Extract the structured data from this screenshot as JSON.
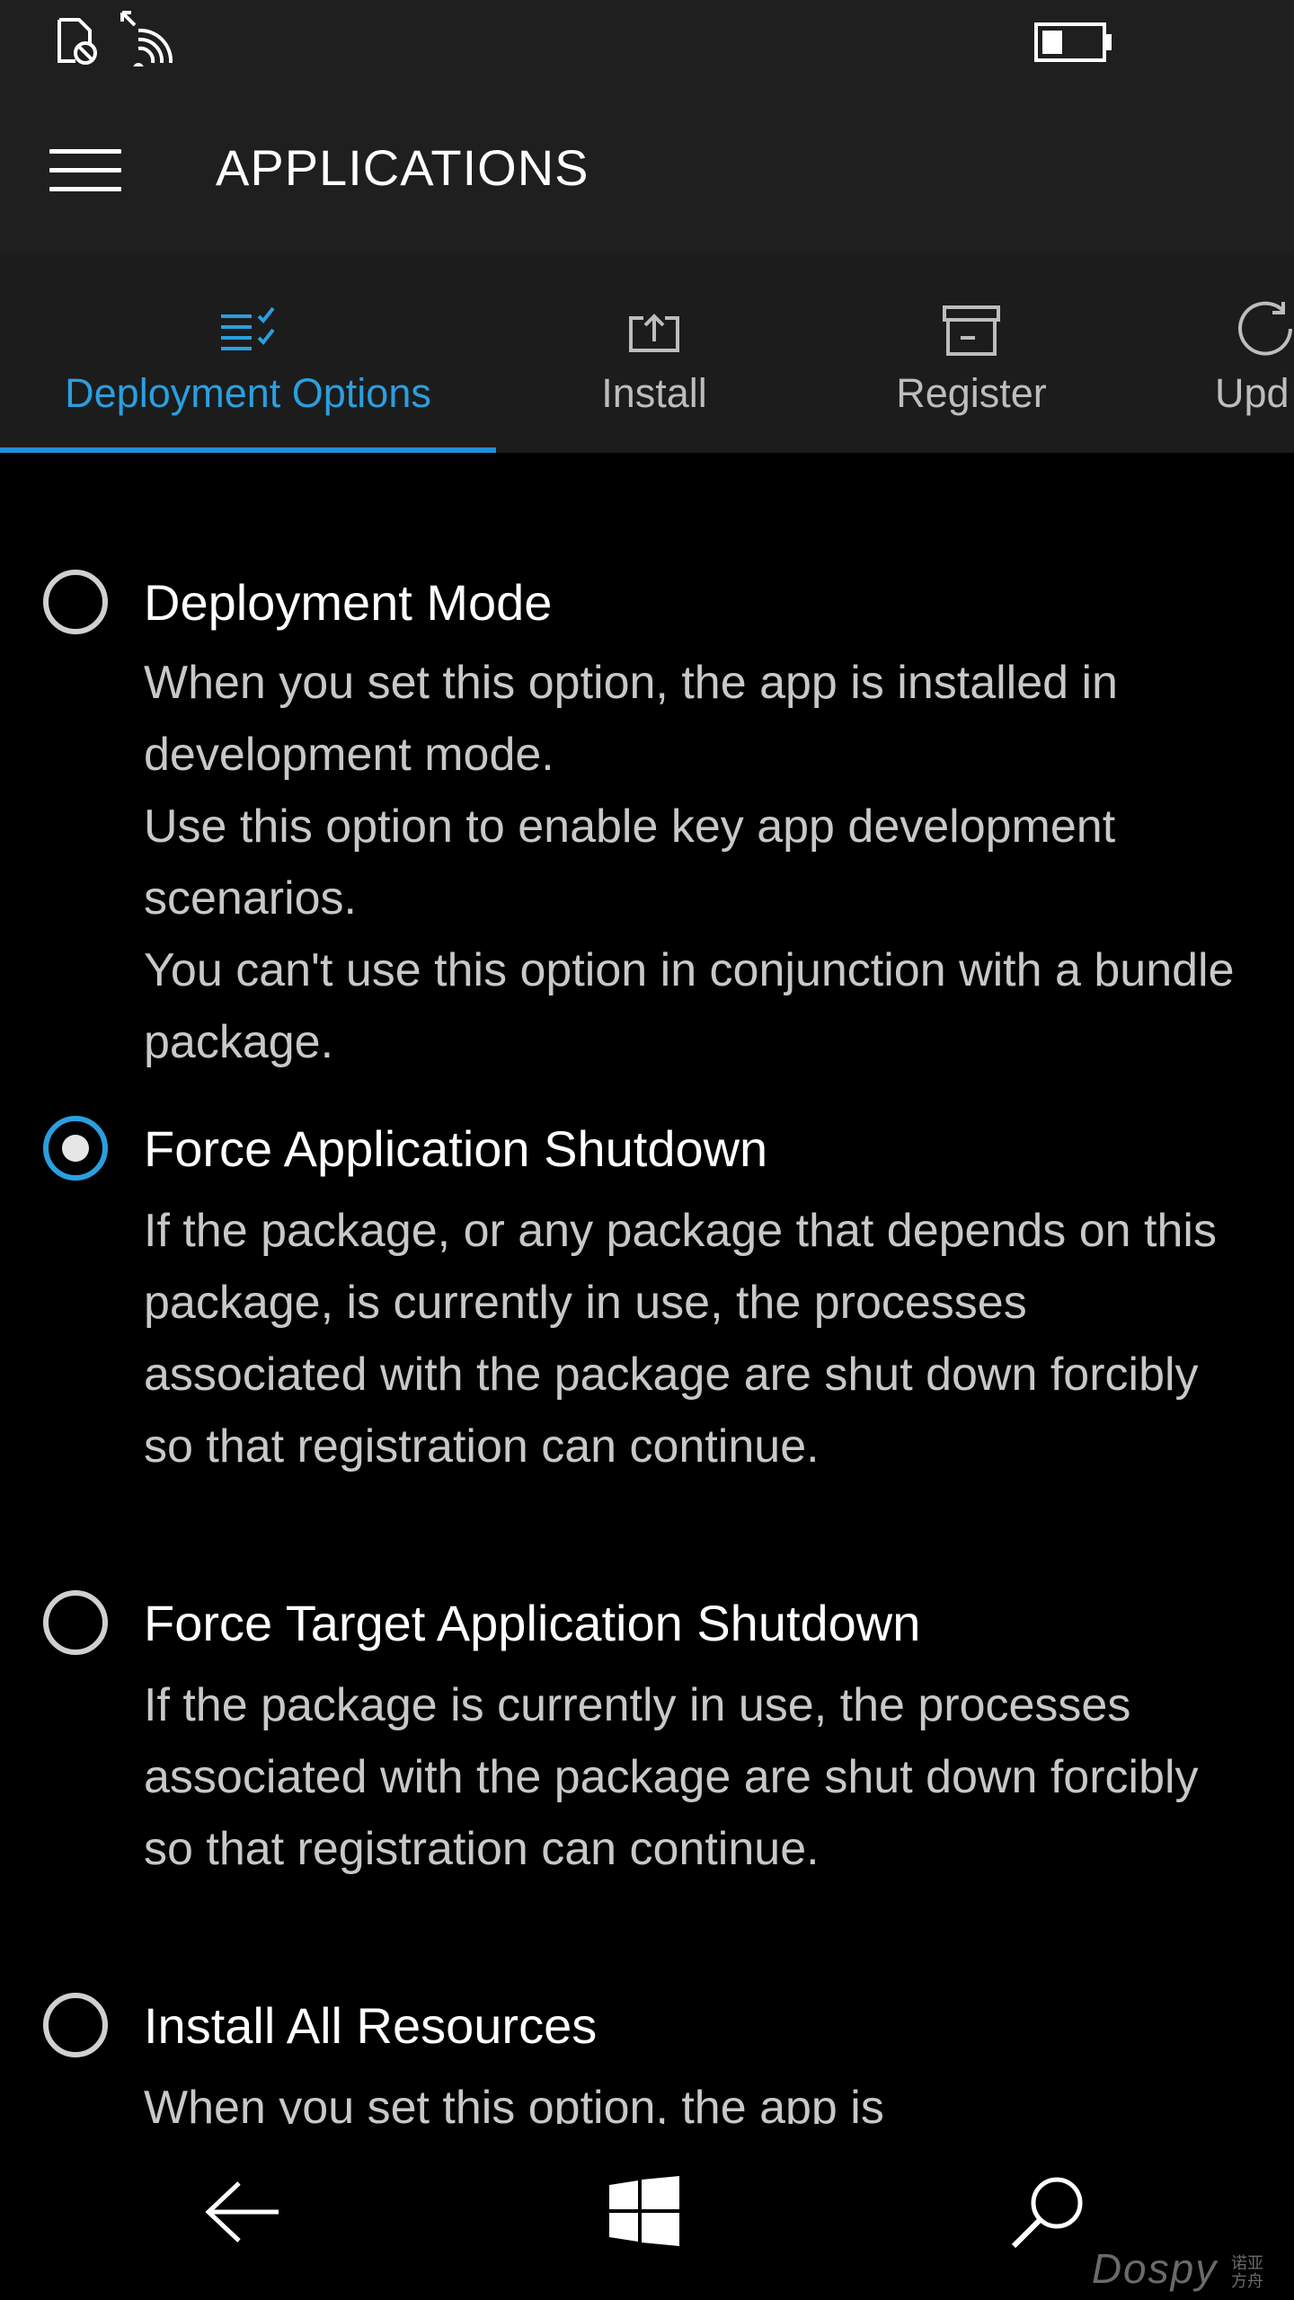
{
  "header": {
    "title": "APPLICATIONS"
  },
  "tabs": [
    {
      "label": "Deployment Options",
      "icon": "checklist-icon",
      "active": true
    },
    {
      "label": "Install",
      "icon": "upload-icon"
    },
    {
      "label": "Register",
      "icon": "archive-icon"
    },
    {
      "label": "Upd",
      "icon": "refresh-icon"
    }
  ],
  "options": [
    {
      "label": "Deployment Mode",
      "checked": false,
      "description": [
        "When you set this option, the app is installed in development mode.",
        "Use this option to enable key app development scenarios.",
        "You can't use this option in conjunction with a bundle package."
      ]
    },
    {
      "label": "Force Application Shutdown",
      "checked": true,
      "description": [
        "If the package, or any package that depends on this package, is currently in use, the processes associated with the package are shut down forcibly so that registration can continue."
      ]
    },
    {
      "label": "Force Target Application Shutdown",
      "checked": false,
      "description": [
        "If the package is currently in use, the processes associated with the package are shut down forcibly so that registration can continue."
      ]
    },
    {
      "label": "Install All Resources",
      "checked": false,
      "description": [
        "When you set this option, the app is"
      ]
    }
  ],
  "watermark": {
    "brand": "Dospy",
    "sub": "诺亚方舟"
  },
  "colors": {
    "accent": "#2a9fdf",
    "bar_bg": "#1f1f1f",
    "background": "#000000"
  }
}
